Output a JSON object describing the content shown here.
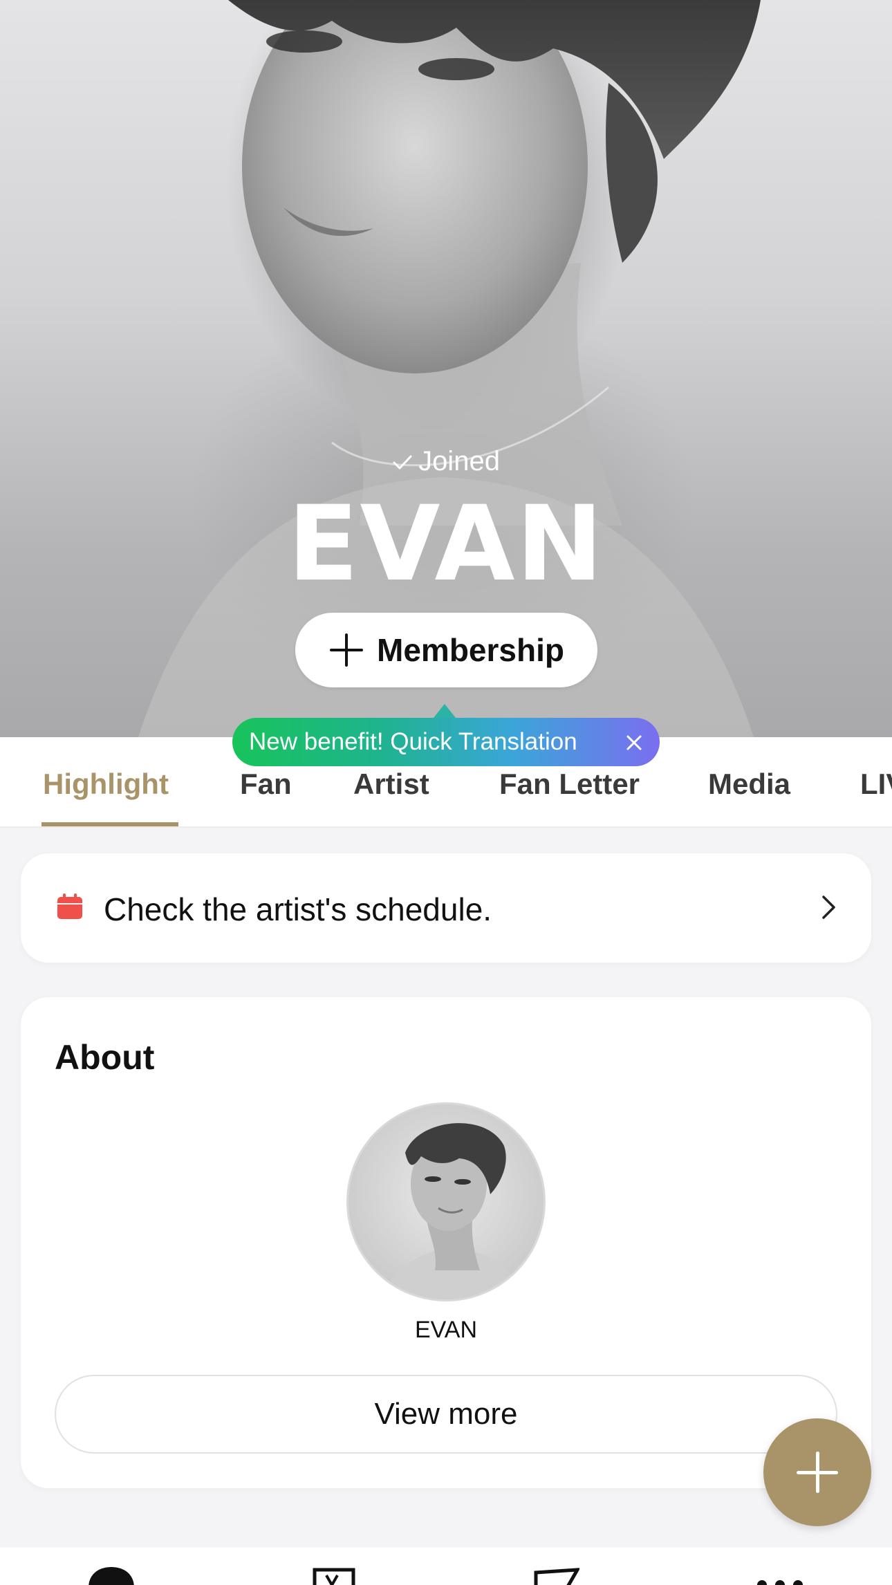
{
  "hero": {
    "joined_label": "Joined",
    "artist_name": "EVAN",
    "membership_label": "Membership"
  },
  "tooltip": {
    "text": "New benefit! Quick Translation"
  },
  "tabs": [
    {
      "label": "Highlight",
      "active": true
    },
    {
      "label": "Fan",
      "active": false
    },
    {
      "label": "Artist",
      "active": false
    },
    {
      "label": "Fan Letter",
      "active": false
    },
    {
      "label": "Media",
      "active": false
    },
    {
      "label": "LIVE",
      "active": false
    }
  ],
  "schedule": {
    "text": "Check the artist's schedule."
  },
  "about": {
    "title": "About",
    "artist_name": "EVAN",
    "view_more_label": "View more"
  },
  "colors": {
    "accent": "#a89468",
    "calendar_icon": "#f0504a",
    "tooltip_gradient": [
      "#17c45a",
      "#3aa6d8",
      "#7b6ef0"
    ]
  },
  "icons": {
    "joined": "checkmark-icon",
    "membership": "plus-icon",
    "tooltip_close": "close-icon",
    "schedule": "calendar-icon",
    "schedule_arrow": "chevron-right-icon",
    "fab": "plus-icon",
    "nav": [
      "home-icon",
      "tv-icon",
      "send-icon",
      "more-icon"
    ]
  }
}
